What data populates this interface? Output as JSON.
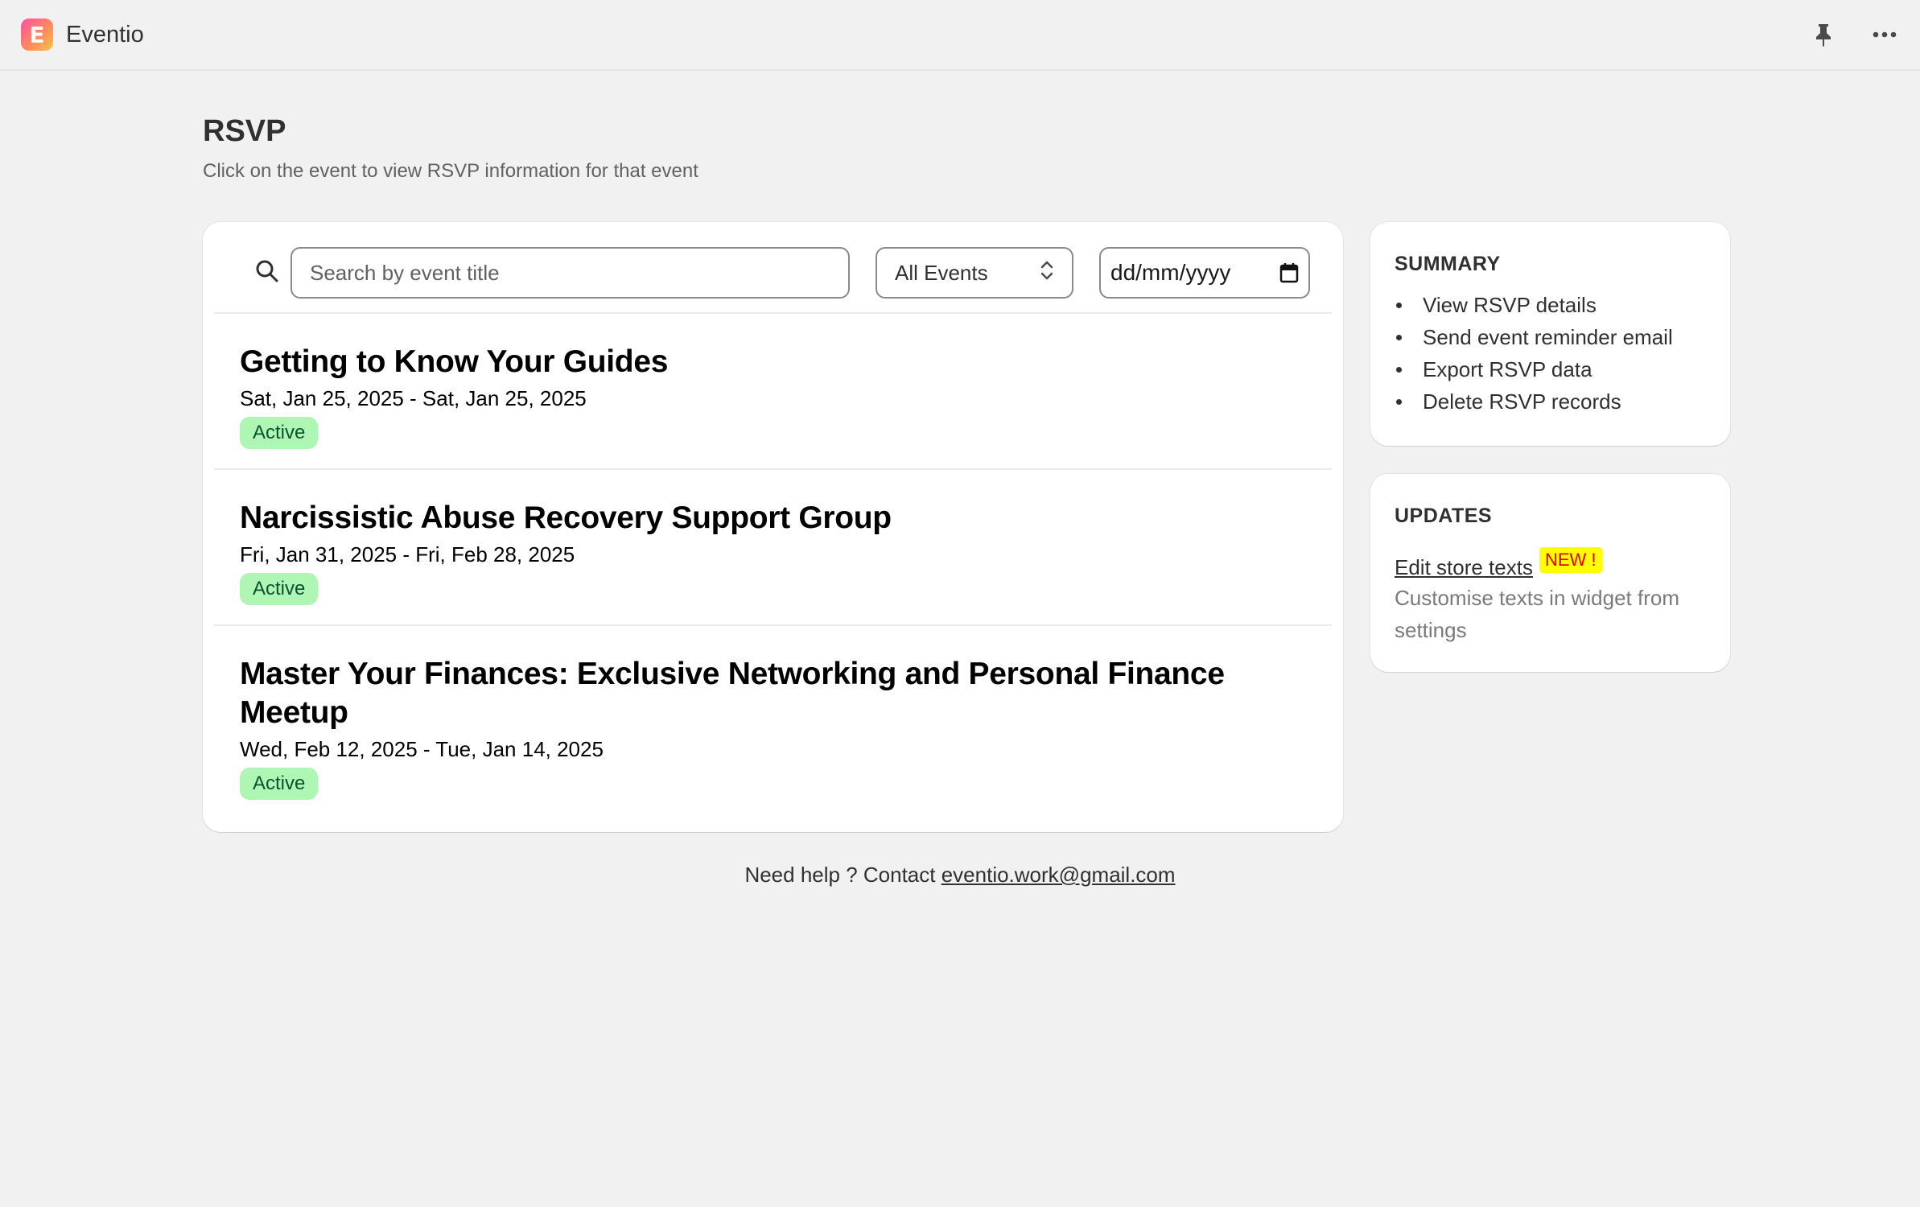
{
  "app": {
    "name": "Eventio",
    "logo_letter": "E"
  },
  "topbar": {
    "pin_icon": "pin-icon",
    "more_icon": "more-horizontal-icon"
  },
  "header": {
    "title": "RSVP",
    "subtitle": "Click on the event to view RSVP information for that event"
  },
  "filters": {
    "search_placeholder": "Search by event title",
    "search_value": "",
    "event_filter": "All Events",
    "date_placeholder": "dd/mm/yyyy"
  },
  "events": [
    {
      "title": "Getting to Know Your Guides",
      "dates": "Sat, Jan 25, 2025 - Sat, Jan 25, 2025",
      "status": "Active"
    },
    {
      "title": "Narcissistic Abuse Recovery Support Group",
      "dates": "Fri, Jan 31, 2025 - Fri, Feb 28, 2025",
      "status": "Active"
    },
    {
      "title": "Master Your Finances: Exclusive Networking and Personal Finance Meetup",
      "dates": "Wed, Feb 12, 2025 - Tue, Jan 14, 2025",
      "status": "Active"
    }
  ],
  "summary": {
    "heading": "SUMMARY",
    "items": [
      "View RSVP details",
      "Send event reminder email",
      "Export RSVP data",
      "Delete RSVP records"
    ]
  },
  "updates": {
    "heading": "UPDATES",
    "link": "Edit store texts",
    "badge": "NEW !",
    "description": "Customise texts in widget from settings"
  },
  "help": {
    "prefix": "Need help ? Contact ",
    "email": "eventio.work@gmail.com"
  },
  "colors": {
    "badge_bg": "#aff5b4",
    "badge_text": "#0c5132",
    "new_badge_bg": "#ffff00",
    "new_badge_text": "#e00000"
  }
}
